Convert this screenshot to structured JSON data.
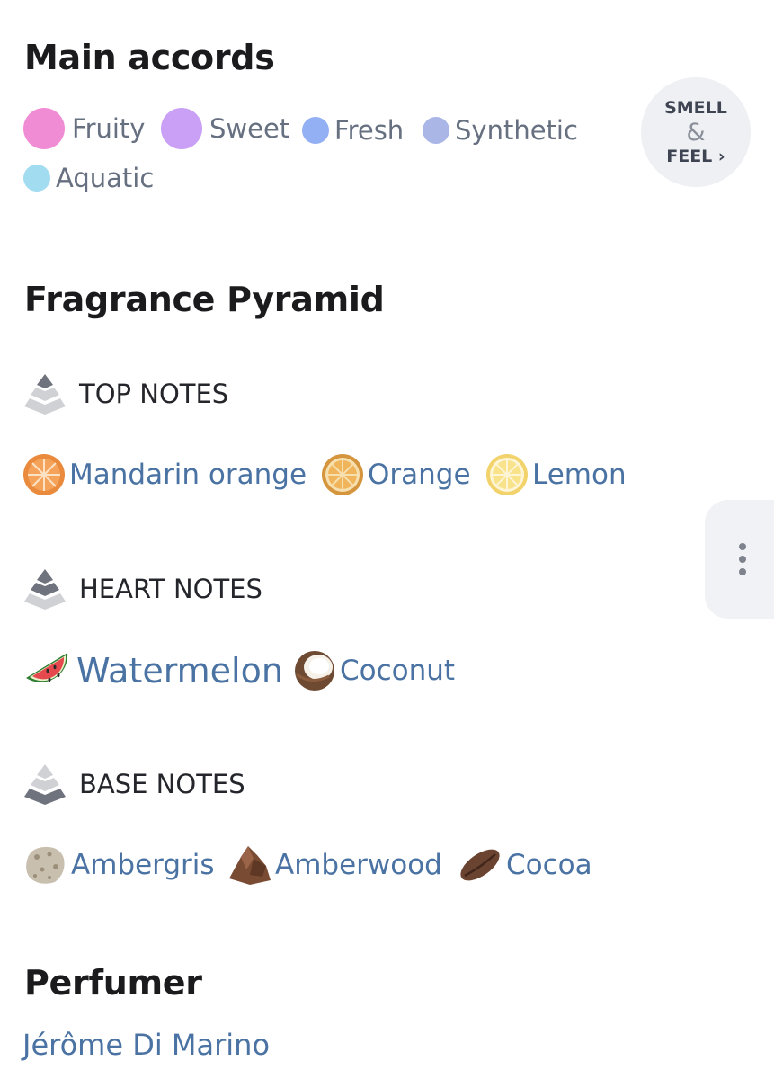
{
  "main_accords": {
    "title": "Main accords",
    "accords": [
      {
        "label": "Fruity",
        "color": "#f08cd4"
      },
      {
        "label": "Sweet",
        "color": "#c9a0f5"
      },
      {
        "label": "Fresh",
        "color": "#94b0f5"
      },
      {
        "label": "Synthetic",
        "color": "#aab6e6"
      },
      {
        "label": "Aquatic",
        "color": "#a2dcf0"
      }
    ],
    "smell_feel": {
      "line1": "SMELL",
      "amp": "&",
      "line2": "FEEL ›"
    }
  },
  "pyramid": {
    "title": "Fragrance Pyramid",
    "top": {
      "label": "TOP NOTES",
      "notes": [
        {
          "label": "Mandarin orange",
          "icon": "mandarin-orange-icon"
        },
        {
          "label": "Orange",
          "icon": "orange-slice-icon"
        },
        {
          "label": "Lemon",
          "icon": "lemon-slice-icon"
        }
      ]
    },
    "heart": {
      "label": "HEART NOTES",
      "notes": [
        {
          "label": "Watermelon",
          "icon": "watermelon-icon"
        },
        {
          "label": "Coconut",
          "icon": "coconut-icon"
        }
      ]
    },
    "base": {
      "label": "BASE NOTES",
      "notes": [
        {
          "label": "Ambergris",
          "icon": "ambergris-icon"
        },
        {
          "label": "Amberwood",
          "icon": "amberwood-icon"
        },
        {
          "label": "Cocoa",
          "icon": "cocoa-bean-icon"
        }
      ]
    }
  },
  "perfumer": {
    "title": "Perfumer",
    "name": "Jérôme Di Marino"
  }
}
